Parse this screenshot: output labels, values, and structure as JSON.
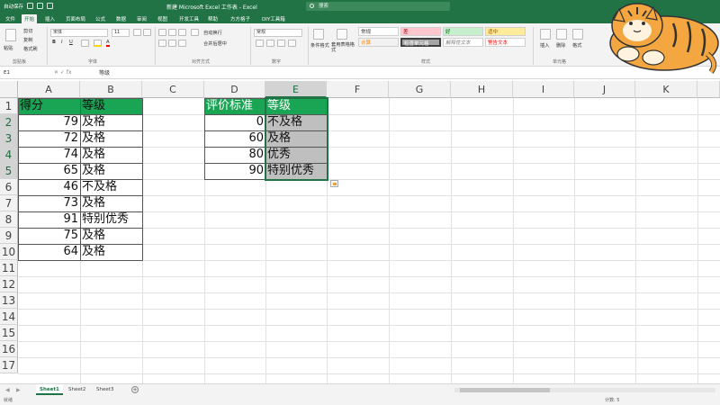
{
  "titlebar": {
    "autosave": "自动保存",
    "title": "新建 Microsoft Excel 工作表 - Excel",
    "search_placeholder": "搜索"
  },
  "menu": {
    "tabs": [
      "文件",
      "开始",
      "插入",
      "页面布局",
      "公式",
      "数据",
      "审阅",
      "视图",
      "开发工具",
      "帮助",
      "方方格子",
      "DIY工具箱"
    ],
    "active": "开始"
  },
  "ribbon": {
    "clipboard": {
      "paste": "粘贴",
      "cut": "剪切",
      "copy": "复制",
      "format_painter": "格式刷",
      "label": "剪贴板"
    },
    "font": {
      "name": "宋体",
      "size": "11",
      "label": "字体"
    },
    "alignment": {
      "wrap": "自动换行",
      "merge": "合并后居中",
      "label": "对齐方式"
    },
    "number": {
      "format": "常规",
      "label": "数字"
    },
    "styles": {
      "conditional": "条件格式",
      "table": "套用表格格式",
      "cells": [
        "常规",
        "差",
        "好",
        "适中",
        "计算",
        "检查单元格",
        "解释性文本",
        "警告文本"
      ],
      "label": "样式"
    },
    "cells_group": {
      "insert": "插入",
      "delete": "删除",
      "format": "格式",
      "label": "单元格"
    },
    "colors": {
      "bad": "#ffc7ce",
      "good": "#c6efce",
      "neutral": "#ffeb9c",
      "calc": "#f2f2f2",
      "check": "#a5a5a5",
      "warn_text": "#ff0000"
    }
  },
  "formula_bar": {
    "name_box": "E1",
    "content": "等级"
  },
  "columns": [
    "A",
    "B",
    "C",
    "D",
    "E",
    "F",
    "G",
    "H",
    "I",
    "J",
    "K"
  ],
  "rows": [
    "1",
    "2",
    "3",
    "4",
    "5",
    "6",
    "7",
    "8",
    "9",
    "10",
    "11",
    "12",
    "13",
    "14",
    "15",
    "16",
    "17"
  ],
  "sheet": {
    "a1": "得分",
    "b1": "等级",
    "scores": [
      {
        "score": "79",
        "grade": "及格"
      },
      {
        "score": "72",
        "grade": "及格"
      },
      {
        "score": "74",
        "grade": "及格"
      },
      {
        "score": "65",
        "grade": "及格"
      },
      {
        "score": "46",
        "grade": "不及格"
      },
      {
        "score": "73",
        "grade": "及格"
      },
      {
        "score": "91",
        "grade": "特别优秀"
      },
      {
        "score": "75",
        "grade": "及格"
      },
      {
        "score": "64",
        "grade": "及格"
      }
    ],
    "d1": "评价标准",
    "e1": "等级",
    "criteria": [
      {
        "threshold": "0",
        "grade": "不及格"
      },
      {
        "threshold": "60",
        "grade": "及格"
      },
      {
        "threshold": "80",
        "grade": "优秀"
      },
      {
        "threshold": "90",
        "grade": "特别优秀"
      }
    ]
  },
  "sheets": [
    "Sheet1",
    "Sheet2",
    "Sheet3"
  ],
  "active_sheet": "Sheet1",
  "status": {
    "left": "就绪",
    "count": "计数: 5"
  },
  "accent": "#217346"
}
